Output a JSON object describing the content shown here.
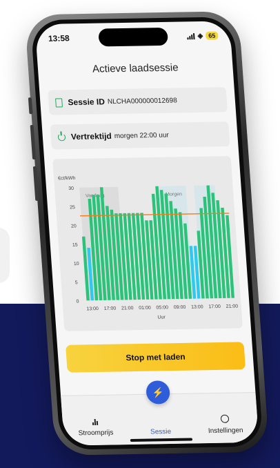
{
  "status": {
    "time": "13:58",
    "battery": "65"
  },
  "title": "Actieve laadsessie",
  "session": {
    "label": "Sessie ID",
    "value": "NLCHA000000012698"
  },
  "departure": {
    "label": "Vertrektijd",
    "value": "morgen 22:00 uur"
  },
  "chart_data": {
    "type": "bar",
    "ylabel": "€ct/kWh",
    "xlabel": "Uur",
    "ylim": [
      0,
      30
    ],
    "yticks": [
      0,
      5,
      10,
      15,
      20,
      25,
      30
    ],
    "xticks": [
      "13:00",
      "17:00",
      "21:00",
      "01:00",
      "05:00",
      "09:00",
      "13:00",
      "17:00",
      "21:00"
    ],
    "regions": [
      "Vandaag",
      "Morgen"
    ],
    "threshold": 22.5,
    "values": [
      17,
      14,
      27,
      28,
      28,
      30,
      25,
      24,
      23,
      23,
      23,
      23,
      23,
      23,
      23,
      21,
      21,
      28,
      30,
      29,
      28,
      26,
      24,
      23,
      20,
      14,
      14,
      18,
      24,
      27,
      30,
      28,
      26,
      24,
      22
    ],
    "charging": [
      0,
      1,
      0,
      0,
      0,
      0,
      0,
      0,
      0,
      0,
      0,
      0,
      0,
      0,
      0,
      0,
      0,
      0,
      0,
      0,
      0,
      0,
      0,
      0,
      0,
      1,
      1,
      0,
      0,
      0,
      0,
      0,
      0,
      0,
      0
    ],
    "colors": {
      "bar": "#2bc27a",
      "charging": "#2ec9f0",
      "threshold": "#ef7d1a"
    }
  },
  "stop_button": "Stop met laden",
  "tabs": [
    {
      "label": "Stroomprijs",
      "icon": "bar-chart-icon"
    },
    {
      "label": "Sessie",
      "icon": "lightning-icon"
    },
    {
      "label": "Instellingen",
      "icon": "gear-icon"
    }
  ]
}
